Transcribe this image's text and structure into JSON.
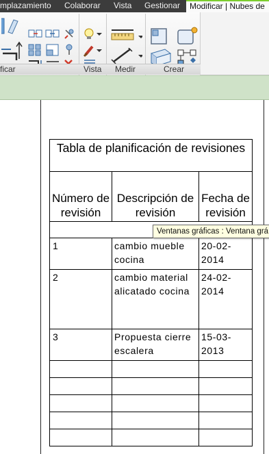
{
  "ribbon_tabs": [
    {
      "label": "mplazamiento"
    },
    {
      "label": "Colaborar"
    },
    {
      "label": "Vista"
    },
    {
      "label": "Gestionar"
    },
    {
      "label": "Modificar | Nubes de"
    }
  ],
  "ribbon_panels": {
    "modificar": "ficar",
    "vista": "Vista",
    "medir": "Medir",
    "crear": "Crear"
  },
  "schedule": {
    "title": "Tabla de planificación de revisiones",
    "headers": [
      "Número de revisión",
      "Descripción de revisión",
      "Fecha de revisión"
    ],
    "rows": [
      {
        "number": "1",
        "description": "cambio mueble cocina",
        "date": "20-02-2014"
      },
      {
        "number": "2",
        "description": "cambio material alicatado cocina",
        "date": "24-02-2014"
      },
      {
        "number": "3",
        "description": "Propuesta cierre escalera",
        "date": "15-03-2013"
      }
    ]
  },
  "tooltip": {
    "text": "Ventanas gráficas : Ventana grá"
  },
  "colors": {
    "ribbon_tab_bar": "#3c3c3c",
    "active_tab_accent": "#7ccd2e",
    "options_bar": "#cfe2c8",
    "tooltip_bg": "#ffffe1"
  }
}
